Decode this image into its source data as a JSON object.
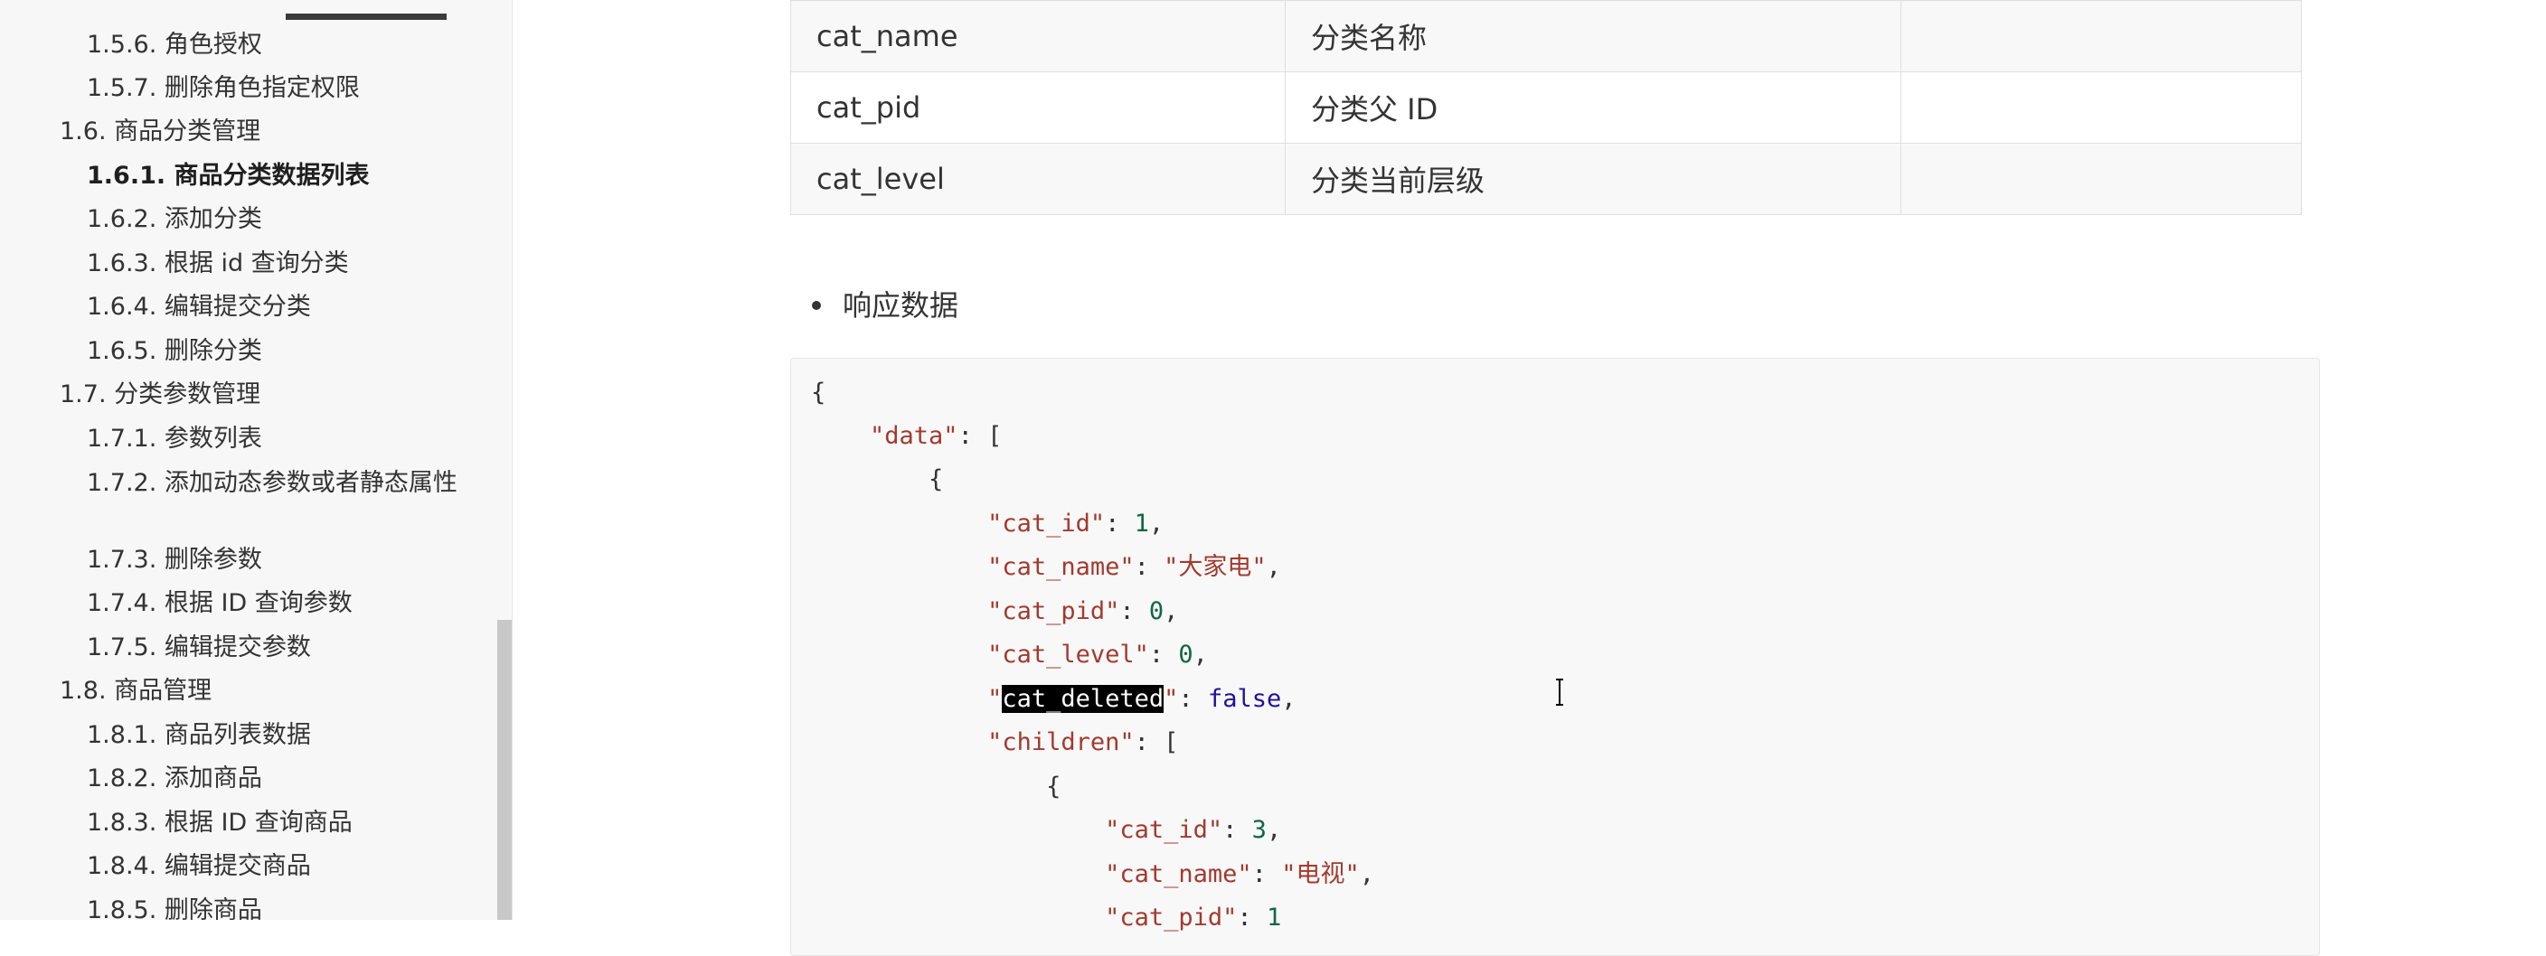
{
  "sidebar": {
    "items": [
      {
        "label": "1.5.6. 角色授权",
        "level": 3
      },
      {
        "label": "1.5.7. 删除角色指定权限",
        "level": 3
      },
      {
        "label": "1.6. 商品分类管理",
        "level": 2
      },
      {
        "label": "1.6.1. 商品分类数据列表",
        "level": 3,
        "active": true
      },
      {
        "label": "1.6.2. 添加分类",
        "level": 3
      },
      {
        "label": "1.6.3. 根据 id 查询分类",
        "level": 3
      },
      {
        "label": "1.6.4. 编辑提交分类",
        "level": 3
      },
      {
        "label": "1.6.5. 删除分类",
        "level": 3
      },
      {
        "label": "1.7. 分类参数管理",
        "level": 2
      },
      {
        "label": "1.7.1. 参数列表",
        "level": 3
      },
      {
        "label": "1.7.2. 添加动态参数或者静态属性",
        "level": 3
      },
      {
        "label": "1.7.3. 删除参数",
        "level": 3
      },
      {
        "label": "1.7.4. 根据 ID 查询参数",
        "level": 3
      },
      {
        "label": "1.7.5. 编辑提交参数",
        "level": 3
      },
      {
        "label": "1.8. 商品管理",
        "level": 2
      },
      {
        "label": "1.8.1. 商品列表数据",
        "level": 3
      },
      {
        "label": "1.8.2. 添加商品",
        "level": 3
      },
      {
        "label": "1.8.3. 根据 ID 查询商品",
        "level": 3
      },
      {
        "label": "1.8.4. 编辑提交商品",
        "level": 3
      },
      {
        "label": "1.8.5. 删除商品",
        "level": 3
      }
    ]
  },
  "param_table": {
    "rows": [
      [
        "cat_name",
        "分类名称",
        ""
      ],
      [
        "cat_pid",
        "分类父 ID",
        ""
      ],
      [
        "cat_level",
        "分类当前层级",
        ""
      ]
    ]
  },
  "response_heading": "响应数据",
  "code": {
    "l1": "{",
    "l2_key": "\"data\"",
    "l2_rest": ": [",
    "l3": "{",
    "l4_key": "\"cat_id\"",
    "l4_val": "1",
    "l5_key": "\"cat_name\"",
    "l5_val": "\"大家电\"",
    "l6_key": "\"cat_pid\"",
    "l6_val": "0",
    "l7_key": "\"cat_level\"",
    "l7_val": "0",
    "l8_key_selected": "cat_deleted",
    "l8_val": "false",
    "l9_key": "\"children\"",
    "l9_rest": ": [",
    "l10": "{",
    "l11_key": "\"cat_id\"",
    "l11_val": "3",
    "l12_key": "\"cat_name\"",
    "l12_val": "\"电视\"",
    "l13_key": "\"cat_pid\"",
    "l13_val": "1"
  }
}
